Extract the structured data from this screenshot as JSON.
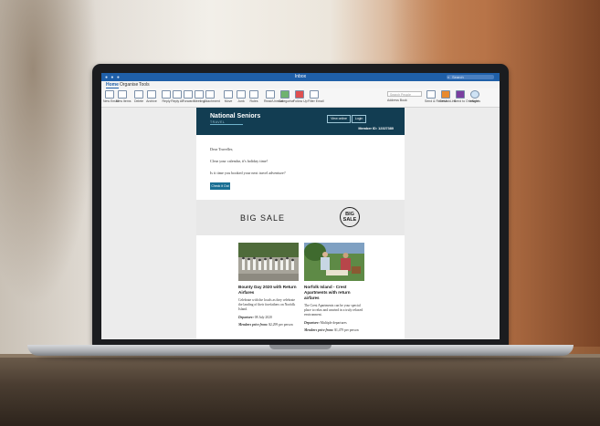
{
  "window": {
    "title": "Inbox",
    "search_placeholder": "Search"
  },
  "ribbon_tabs": [
    {
      "label": "Home",
      "active": true
    },
    {
      "label": "Organise",
      "active": false
    },
    {
      "label": "Tools",
      "active": false
    }
  ],
  "ribbon": {
    "buttons": [
      "New Email",
      "New Items",
      "Delete",
      "Archive",
      "Reply",
      "Reply All",
      "Forward",
      "Meeting",
      "Attachment",
      "Move",
      "Junk",
      "Rules",
      "Read/Unread",
      "Categorise",
      "Follow Up",
      "Filter Email",
      "Send & Receive",
      "Get Add-ins",
      "Send to OneNote",
      "Insights"
    ],
    "search_placeholder": "Search People",
    "address_book": "Address Book"
  },
  "email": {
    "brand": "National Seniors",
    "brand_sub": "TRAVEL",
    "view_online": "View online",
    "login": "Login",
    "member_id": "Member ID: 12327380",
    "greeting": "Dear Traveller,",
    "line1": "Clear your calendar, it's holiday time!",
    "line2": "Is it time you booked your next travel adventure?",
    "cta": "Check it Out",
    "sale_text": "BIG SALE",
    "badge_line1": "BIG",
    "badge_line2": "SALE",
    "cards": [
      {
        "title": "Bounty Day 2020 with Return Airfares",
        "desc": "Celebrate with the locals as they celebrate the landing of their forefathers on Norfolk Island.",
        "departure_label": "Departure:",
        "departure": "08 July 2020",
        "price_label": "Members price from:",
        "price": "$2,299 per person"
      },
      {
        "title": "Norfolk Island - Crest Apartments with return airfares",
        "desc": "The Crest Apartments can be your special place to relax and unwind in a truly relaxed environment.",
        "departure_label": "Departure:",
        "departure": "Multiple departures",
        "price_label": "Members price from:",
        "price": "$1,479 per person"
      }
    ]
  }
}
